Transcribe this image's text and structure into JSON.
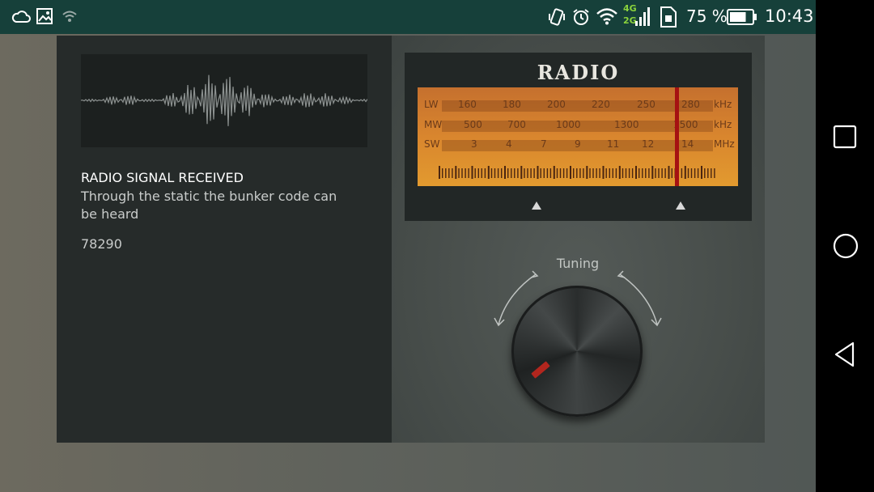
{
  "status_bar": {
    "network_type_top": "4G",
    "network_type_bottom": "2G",
    "battery_percent": "75 %",
    "battery_level": 0.75,
    "time": "10:43",
    "icons": [
      "cloud-icon",
      "gallery-icon",
      "wifi-small-icon",
      "vibrate-icon",
      "alarm-icon",
      "wifi-icon",
      "signal-icon",
      "sim-icon",
      "battery-icon"
    ]
  },
  "signal_panel": {
    "title": "RADIO SIGNAL RECEIVED",
    "description": "Through the static the bunker code can be heard",
    "code": "78290"
  },
  "radio": {
    "title": "RADIO",
    "bands": [
      {
        "label": "LW",
        "values": [
          "160",
          "180",
          "200",
          "220",
          "250",
          "280"
        ],
        "unit": "kHz"
      },
      {
        "label": "MW",
        "values": [
          "500",
          "700",
          "1000",
          "1300",
          "1500"
        ],
        "unit": "kHz"
      },
      {
        "label": "SW",
        "values": [
          "3",
          "4",
          "7",
          "9",
          "11",
          "12",
          "14"
        ],
        "unit": "MHz"
      }
    ],
    "tuning_label": "Tuning"
  },
  "nav_bar": {
    "icons": [
      "recents-icon",
      "home-icon",
      "back-icon"
    ]
  },
  "colors": {
    "status_bar_bg": "#16403a",
    "dial_orange": "#d9862e",
    "needle_red": "#a51212",
    "network_green": "#8bd33c"
  }
}
